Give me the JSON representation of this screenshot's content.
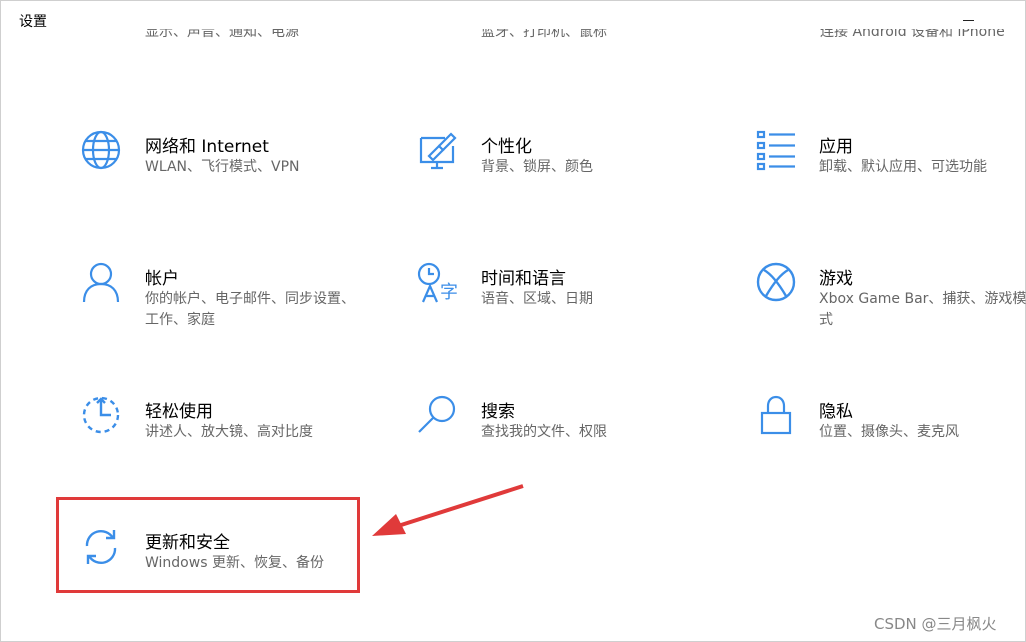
{
  "window": {
    "title": "设置"
  },
  "colors": {
    "accent": "#3b8ee8",
    "highlight": "#e03a3a"
  },
  "cut_row": [
    "显示、声音、通知、电源",
    "蓝牙、打印机、鼠标",
    "连接 Android 设备和 iPhone"
  ],
  "tiles": [
    {
      "name": "网络和 Internet",
      "desc": "WLAN、飞行模式、VPN",
      "icon": "globe-icon"
    },
    {
      "name": "个性化",
      "desc": "背景、锁屏、颜色",
      "icon": "paint-monitor-icon"
    },
    {
      "name": "应用",
      "desc": "卸载、默认应用、可选功能",
      "icon": "apps-list-icon"
    },
    {
      "name": "帐户",
      "desc": "你的帐户、电子邮件、同步设置、工作、家庭",
      "icon": "person-icon"
    },
    {
      "name": "时间和语言",
      "desc": "语音、区域、日期",
      "icon": "time-language-icon"
    },
    {
      "name": "游戏",
      "desc": "Xbox Game Bar、捕获、游戏模式",
      "icon": "xbox-icon"
    },
    {
      "name": "轻松使用",
      "desc": "讲述人、放大镜、高对比度",
      "icon": "ease-of-access-icon"
    },
    {
      "name": "搜索",
      "desc": "查找我的文件、权限",
      "icon": "search-icon"
    },
    {
      "name": "隐私",
      "desc": "位置、摄像头、麦克风",
      "icon": "lock-icon"
    },
    {
      "name": "更新和安全",
      "desc": "Windows 更新、恢复、备份",
      "icon": "sync-icon"
    }
  ],
  "watermark": "CSDN @三月枫火"
}
